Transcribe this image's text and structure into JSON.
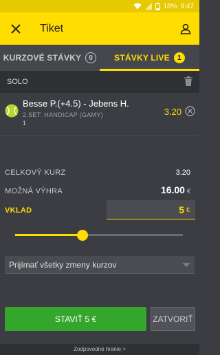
{
  "status_bar": {
    "battery": "18%",
    "time": "9:47"
  },
  "header": {
    "title": "Tiket"
  },
  "tabs": [
    {
      "label": "KURZOVÉ STÁVKY",
      "count": "0"
    },
    {
      "label": "STÁVKY LIVE",
      "count": "1"
    }
  ],
  "ticket": {
    "type_label": "SOLO"
  },
  "bet": {
    "match": "Besse P.(+4.5) - Jebens H.",
    "market": "2.SET: HANDICAP (GAMY)",
    "selection": "1",
    "odds": "3.20"
  },
  "summary": {
    "total_odds_label": "CELKOVÝ KURZ",
    "total_odds": "3.20",
    "possible_win_label": "MOŽNÁ VÝHRA",
    "possible_win": "16.00",
    "stake_label": "VKLAD",
    "stake": "5",
    "currency": "€"
  },
  "stake_slider": {
    "level": 0.4
  },
  "odds_change": {
    "selected": "Prijímať všetky zmeny kurzov"
  },
  "actions": {
    "place_label": "STAVIŤ 5 €",
    "close_label": "ZATVORIŤ"
  },
  "footer": {
    "link": "Zodpovedné hranie >"
  },
  "colors": {
    "accent": "#ffdd00",
    "primary_button": "#35a62c",
    "background": "#3b3d42"
  }
}
